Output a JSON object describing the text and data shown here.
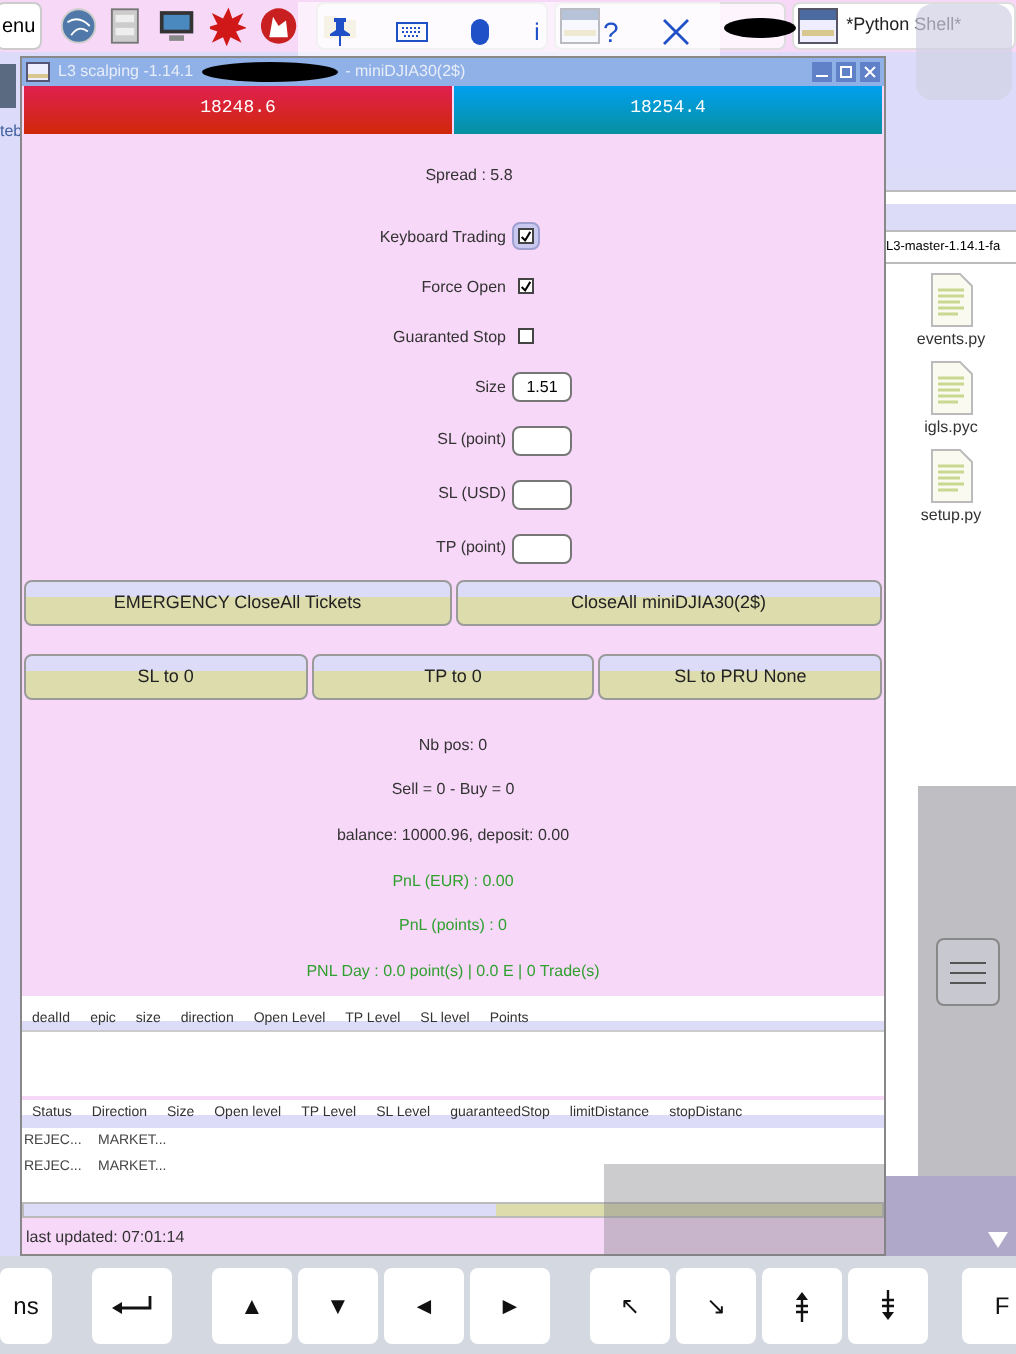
{
  "taskbar": {
    "menu_label": "enu",
    "tasks": [
      {
        "kind": "folder"
      },
      {
        "kind": "window"
      },
      {
        "label": "*Python Shell*",
        "kind": "window"
      }
    ]
  },
  "floating_toolbar": {
    "info": "i",
    "help": "?"
  },
  "desktop": {
    "icon_label": "teb"
  },
  "window": {
    "title_start": "L3 scalping -1.14.1",
    "title_end": "- miniDJIA30(2$)"
  },
  "prices": {
    "bid": "18248.6",
    "ask": "18254.4"
  },
  "spread": "Spread : 5.8",
  "options": [
    {
      "label": "Keyboard Trading",
      "checked": true,
      "focused": true
    },
    {
      "label": "Force Open",
      "checked": true,
      "focused": false
    },
    {
      "label": "Guaranted Stop",
      "checked": false,
      "focused": false
    }
  ],
  "fields": [
    {
      "label": "Size",
      "value": "1.51"
    },
    {
      "label": "SL (point)"
    },
    {
      "label": "SL (USD)"
    },
    {
      "label": "TP (point)"
    }
  ],
  "buttons_row_1": [
    "EMERGENCY CloseAll Tickets",
    "CloseAll miniDJIA30(2$)"
  ],
  "buttons_row_2": [
    "SL to 0",
    "TP to 0",
    "SL to PRU None"
  ],
  "stats": [
    {
      "text": "Nb pos: 0",
      "kind": "plain"
    },
    {
      "text": "Sell = 0 - Buy = 0",
      "kind": "plain"
    },
    {
      "text": "balance: 10000.96, deposit: 0.00",
      "kind": "plain"
    },
    {
      "text": "PnL (EUR) : 0.00",
      "kind": "pnl"
    },
    {
      "text": "PnL (points) : 0",
      "kind": "pnl"
    },
    {
      "text": "PNL Day : 0.0 point(s) | 0.0 E | 0 Trade(s)",
      "kind": "pnl"
    }
  ],
  "positions_table": {
    "columns": [
      "dealId",
      "epic",
      "size",
      "direction",
      "Open Level",
      "TP Level",
      "SL level",
      "Points"
    ]
  },
  "orders_table": {
    "columns": [
      "Status",
      "Direction",
      "Size",
      "Open level",
      "TP Level",
      "SL Level",
      "guaranteedStop",
      "limitDistance",
      "stopDistanc"
    ],
    "rows": [
      [
        "REJEC...",
        "MARKET..."
      ],
      [
        "REJEC...",
        "MARKET..."
      ]
    ]
  },
  "status_bar": "last updated: 07:01:14",
  "file_manager": {
    "path": "L3-master-1.14.1-fa",
    "files": [
      "events.py",
      "igls.pyc",
      "setup.py"
    ]
  },
  "keyboard": {
    "keys": [
      {
        "label": "ns",
        "kind": "text"
      },
      {
        "kind": "enter"
      },
      {
        "label": "▲",
        "kind": "text"
      },
      {
        "label": "▼",
        "kind": "text"
      },
      {
        "label": "◄",
        "kind": "text"
      },
      {
        "label": "►",
        "kind": "text"
      },
      {
        "label": "↖",
        "kind": "text"
      },
      {
        "label": "↘",
        "kind": "text"
      },
      {
        "kind": "page-up"
      },
      {
        "kind": "page-down"
      },
      {
        "label": "F",
        "kind": "text"
      }
    ]
  }
}
